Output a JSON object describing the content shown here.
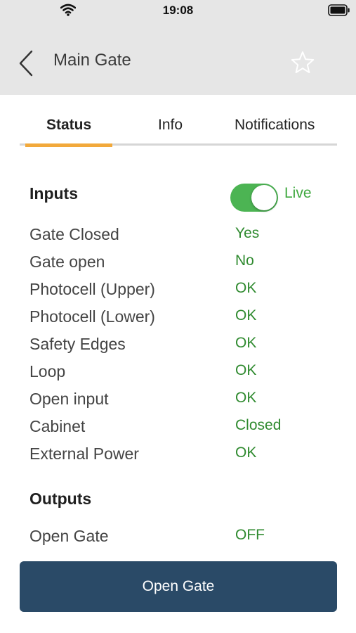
{
  "status_bar": {
    "time": "19:08"
  },
  "header": {
    "title": "Main Gate",
    "back_icon": "chevron-left-icon",
    "favorite_icon": "star-icon"
  },
  "tabs": [
    {
      "label": "Status",
      "active": true
    },
    {
      "label": "Info",
      "active": false
    },
    {
      "label": "Notifications",
      "active": false
    }
  ],
  "inputs": {
    "title": "Inputs",
    "live_toggle": {
      "label": "Live",
      "on": true
    },
    "rows": [
      {
        "label": "Gate Closed",
        "value": "Yes"
      },
      {
        "label": "Gate open",
        "value": "No"
      },
      {
        "label": "Photocell (Upper)",
        "value": "OK"
      },
      {
        "label": "Photocell (Lower)",
        "value": "OK"
      },
      {
        "label": "Safety Edges",
        "value": "OK"
      },
      {
        "label": "Loop",
        "value": "OK"
      },
      {
        "label": "Open input",
        "value": "OK"
      },
      {
        "label": "Cabinet",
        "value": "Closed"
      },
      {
        "label": "External Power",
        "value": "OK"
      }
    ]
  },
  "outputs": {
    "title": "Outputs",
    "rows": [
      {
        "label": "Open Gate",
        "value": "OFF"
      }
    ]
  },
  "action_button": {
    "label": "Open Gate"
  },
  "colors": {
    "accent_tab": "#f2a93b",
    "toggle_on": "#4cb453",
    "value_text": "#2f8a2f",
    "button_bg": "#2a4a67",
    "header_bg": "#e6e6e6"
  }
}
